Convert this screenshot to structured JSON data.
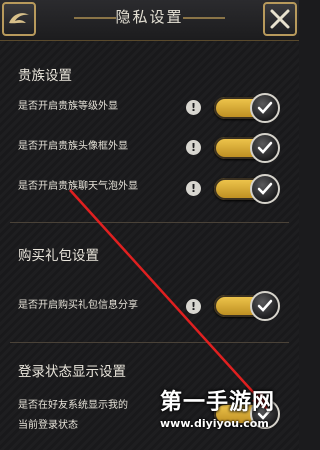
{
  "header": {
    "title": "隐私设置",
    "left_icon": "dragon-emblem-icon",
    "right_icon": "close-icon"
  },
  "sections": [
    {
      "title": "贵族设置",
      "rows": [
        {
          "label": "是否开启贵族等级外显",
          "enabled": true
        },
        {
          "label": "是否开启贵族头像框外显",
          "enabled": true
        },
        {
          "label": "是否开启贵族聊天气泡外显",
          "enabled": true
        }
      ]
    },
    {
      "title": "购买礼包设置",
      "rows": [
        {
          "label": "是否开启购买礼包信息分享",
          "enabled": true
        }
      ]
    },
    {
      "title": "登录状态显示设置",
      "rows": [
        {
          "label_line1": "是否在好友系统显示我的",
          "label_line2": "当前登录状态",
          "enabled": true
        }
      ]
    }
  ],
  "watermark": {
    "brand": "第一手游网",
    "url": "www.diyiyou.com"
  },
  "colors": {
    "toggle_on": "#f2c94f",
    "arrow": "#e02020",
    "accent_gold": "#b89a5c"
  }
}
